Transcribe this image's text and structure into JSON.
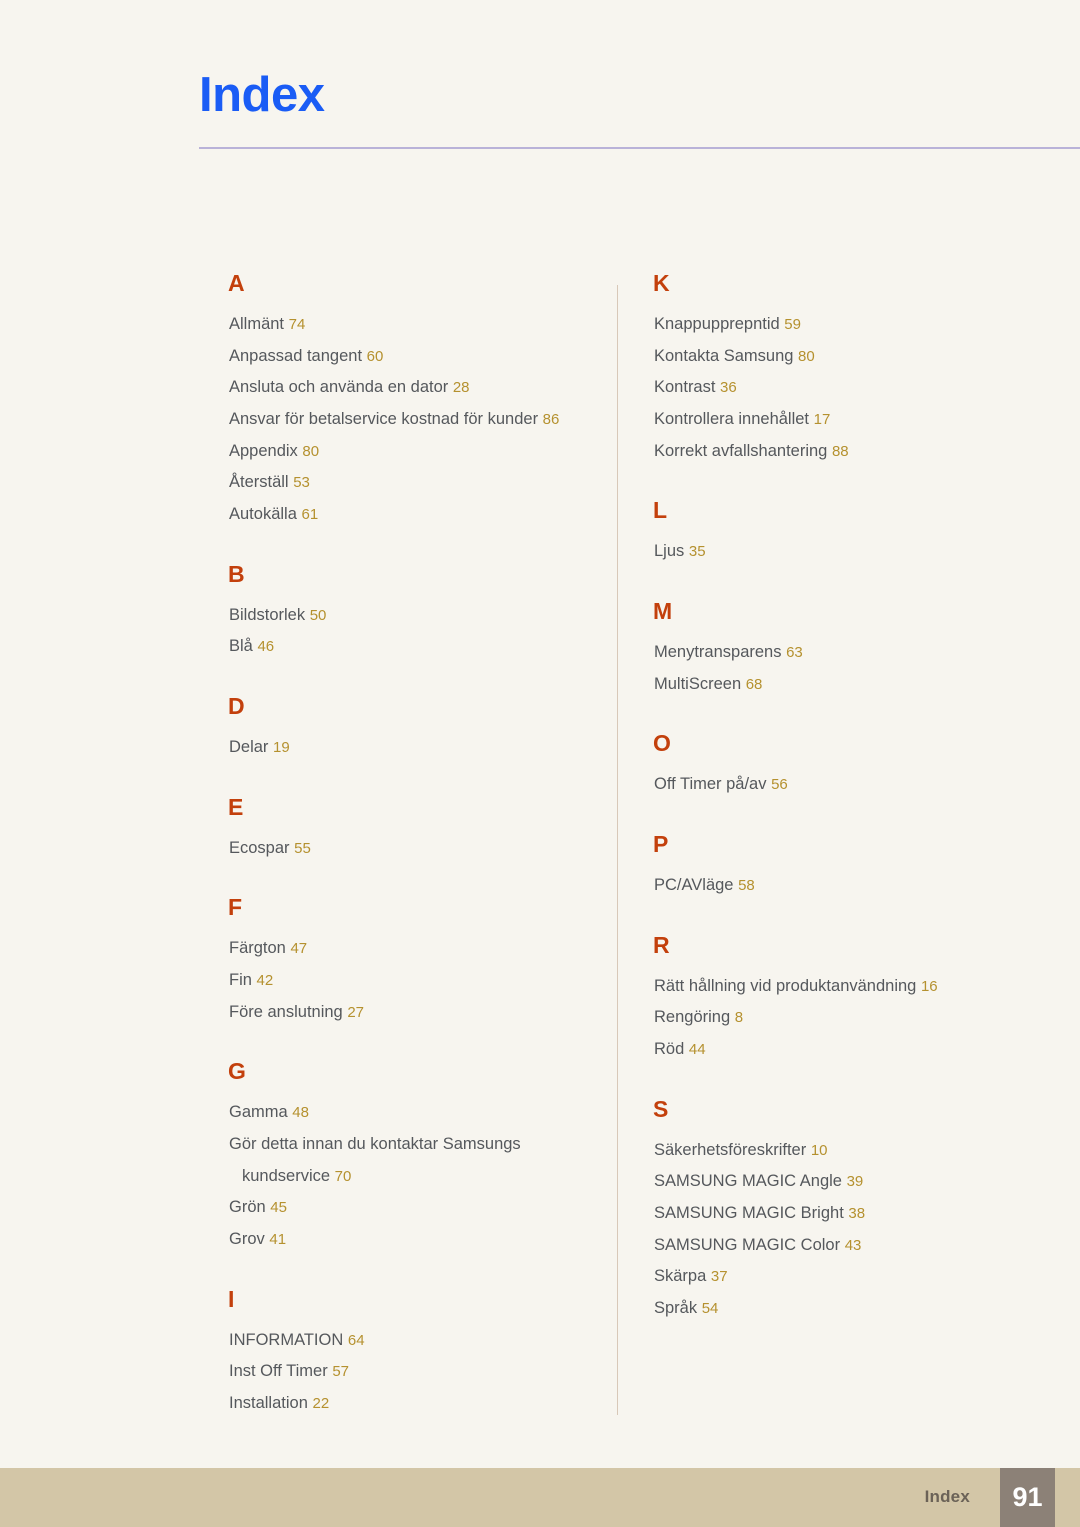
{
  "document": {
    "title": "Index",
    "title_color": "#1a5cf5",
    "rule_color": "#b9b2d8",
    "background_color": "#f7f5ef",
    "section_letter_color": "#c3400c",
    "entry_text_color": "#55585c",
    "page_number_color": "#b5912f"
  },
  "footer": {
    "label": "Index",
    "page_number": "91",
    "bar_color": "#d3c6a7",
    "page_box_color": "#8c8177"
  },
  "columns": [
    {
      "id": "left",
      "sections": [
        {
          "letter": "A",
          "entries": [
            {
              "text": "Allmänt",
              "page": "74"
            },
            {
              "text": "Anpassad tangent",
              "page": "60"
            },
            {
              "text": "Ansluta och använda en dator",
              "page": "28"
            },
            {
              "text": "Ansvar för betalservice kostnad för kunder",
              "page": "86"
            },
            {
              "text": "Appendix",
              "page": "80"
            },
            {
              "text": "Återställ",
              "page": "53"
            },
            {
              "text": "Autokälla",
              "page": "61"
            }
          ]
        },
        {
          "letter": "B",
          "entries": [
            {
              "text": "Bildstorlek",
              "page": "50"
            },
            {
              "text": "Blå",
              "page": "46"
            }
          ]
        },
        {
          "letter": "D",
          "entries": [
            {
              "text": "Delar",
              "page": "19"
            }
          ]
        },
        {
          "letter": "E",
          "entries": [
            {
              "text": "Ecospar",
              "page": "55"
            }
          ]
        },
        {
          "letter": "F",
          "entries": [
            {
              "text": "Färgton",
              "page": "47"
            },
            {
              "text": "Fin",
              "page": "42"
            },
            {
              "text": "Före anslutning",
              "page": "27"
            }
          ]
        },
        {
          "letter": "G",
          "entries": [
            {
              "text": "Gamma",
              "page": "48"
            },
            {
              "text": "Gör detta innan du kontaktar Samsungs",
              "continuation": "kundservice",
              "page": "70"
            },
            {
              "text": "Grön",
              "page": "45"
            },
            {
              "text": "Grov",
              "page": "41"
            }
          ]
        },
        {
          "letter": "I",
          "entries": [
            {
              "text": "INFORMATION",
              "page": "64"
            },
            {
              "text": "Inst Off Timer",
              "page": "57"
            },
            {
              "text": "Installation",
              "page": "22"
            }
          ]
        }
      ]
    },
    {
      "id": "right",
      "sections": [
        {
          "letter": "K",
          "entries": [
            {
              "text": "Knappupprepntid",
              "page": "59"
            },
            {
              "text": "Kontakta Samsung",
              "page": "80"
            },
            {
              "text": "Kontrast",
              "page": "36"
            },
            {
              "text": "Kontrollera innehållet",
              "page": "17"
            },
            {
              "text": "Korrekt avfallshantering",
              "page": "88"
            }
          ]
        },
        {
          "letter": "L",
          "entries": [
            {
              "text": "Ljus",
              "page": "35"
            }
          ]
        },
        {
          "letter": "M",
          "entries": [
            {
              "text": "Menytransparens",
              "page": "63"
            },
            {
              "text": "MultiScreen",
              "page": "68"
            }
          ]
        },
        {
          "letter": "O",
          "entries": [
            {
              "text": "Off Timer på/av",
              "page": "56"
            }
          ]
        },
        {
          "letter": "P",
          "entries": [
            {
              "text": "PC/AVläge",
              "page": "58"
            }
          ]
        },
        {
          "letter": "R",
          "entries": [
            {
              "text": "Rätt hållning vid produktanvändning",
              "page": "16"
            },
            {
              "text": "Rengöring",
              "page": "8"
            },
            {
              "text": "Röd",
              "page": "44"
            }
          ]
        },
        {
          "letter": "S",
          "entries": [
            {
              "text": "Säkerhetsföreskrifter",
              "page": "10"
            },
            {
              "text": "SAMSUNG MAGIC Angle",
              "page": "39"
            },
            {
              "text": "SAMSUNG MAGIC Bright",
              "page": "38"
            },
            {
              "text": "SAMSUNG MAGIC Color",
              "page": "43"
            },
            {
              "text": "Skärpa",
              "page": "37"
            },
            {
              "text": "Språk",
              "page": "54"
            }
          ]
        }
      ]
    }
  ]
}
